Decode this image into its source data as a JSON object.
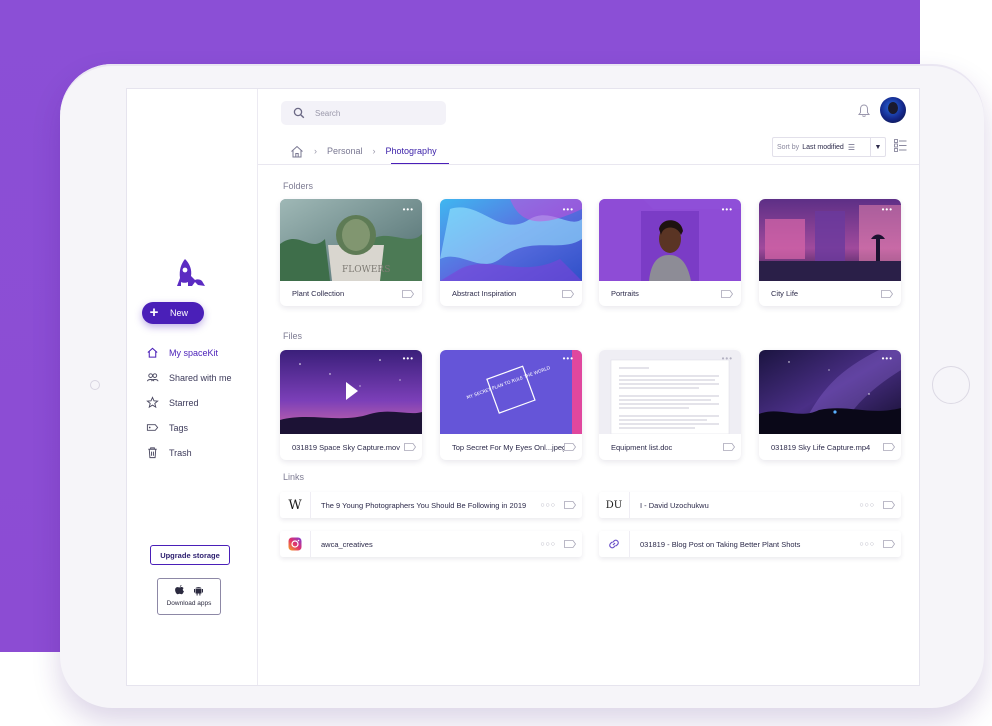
{
  "search": {
    "placeholder": "Search"
  },
  "breadcrumb": {
    "home": "home",
    "items": [
      "Personal",
      "Photography"
    ]
  },
  "sort": {
    "label": "Sort by",
    "value": "Last modified"
  },
  "sidebar": {
    "new_label": "New",
    "items": [
      {
        "label": "My spaceKit",
        "icon": "home-icon",
        "active": true
      },
      {
        "label": "Shared with me",
        "icon": "people-icon"
      },
      {
        "label": "Starred",
        "icon": "star-icon"
      },
      {
        "label": "Tags",
        "icon": "tag-icon"
      },
      {
        "label": "Trash",
        "icon": "trash-icon"
      }
    ],
    "upgrade_label": "Upgrade storage",
    "download_label": "Download apps"
  },
  "sections": {
    "folders": "Folders",
    "files": "Files",
    "links": "Links"
  },
  "folders": [
    {
      "name": "Plant Collection",
      "dots": "•••"
    },
    {
      "name": "Abstract Inspiration",
      "dots": "•••"
    },
    {
      "name": "Portraits",
      "dots": "•••"
    },
    {
      "name": "City Life",
      "dots": "•••"
    }
  ],
  "files": [
    {
      "name": "031819 Space Sky Capture.mov",
      "dots": "•••"
    },
    {
      "name": "Top Secret For My Eyes Onl...jpeg",
      "dots": "•••",
      "cover_text": "MY SECRET PLAN TO RULE THE WORLD"
    },
    {
      "name": "Equipment list.doc",
      "dots": "•••"
    },
    {
      "name": "031819 Sky Life Capture.mp4",
      "dots": "•••"
    }
  ],
  "links": [
    {
      "text": "The 9 Young Photographers You Should Be Following in 2019",
      "icon_text": "W",
      "dots": "○○○"
    },
    {
      "text": "I - David Uzochukwu",
      "icon_text": "DU",
      "dots": "○○○"
    },
    {
      "text": "awca_creatives",
      "icon_text": "",
      "dots": "○○○"
    },
    {
      "text": "031819 - Blog Post on Taking Better Plant Shots",
      "icon_text": "",
      "dots": "○○○"
    }
  ],
  "colors": {
    "brand": "#4a1fb8",
    "background_accent": "#8b4fd6"
  }
}
